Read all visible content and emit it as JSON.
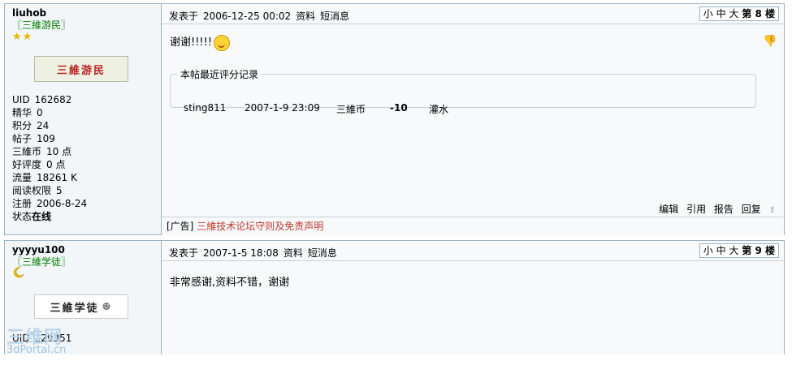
{
  "posts": [
    {
      "username": "liuhob",
      "group": "〖三維游民〗",
      "rank_stars": "★★",
      "badge_text": "三維游民",
      "stats": [
        {
          "label": "UID",
          "value": "162682"
        },
        {
          "label": "精华",
          "value": "0"
        },
        {
          "label": "积分",
          "value": "24"
        },
        {
          "label": "帖子",
          "value": "109"
        },
        {
          "label": "三維币",
          "value": "10 点"
        },
        {
          "label": "好评度",
          "value": "0 点"
        },
        {
          "label": "流量",
          "value": "18261 K"
        },
        {
          "label": "阅读权限",
          "value": "5"
        },
        {
          "label": "注册",
          "value": "2006-8-24"
        },
        {
          "label": "状态",
          "value": "在线"
        }
      ],
      "posted_prefix": "发表于",
      "posted_time": "2006-12-25 00:02",
      "profile_link": "资料",
      "pm_link": "短消息",
      "font_sizes": [
        "小",
        "中",
        "大"
      ],
      "floor_label": "第 8 楼",
      "content": "谢谢!!!!!",
      "rating": {
        "legend": "本帖最近评分记录",
        "user": "sting811",
        "time": "2007-1-9 23:09",
        "currency": "三維币",
        "amount": "-10",
        "reason": "灌水"
      },
      "actions": [
        "编辑",
        "引用",
        "报告",
        "回复"
      ],
      "ad_prefix": "[广告]",
      "ad_text": "三維技术论坛守则及免责声明"
    },
    {
      "username": "yyyyu100",
      "group": "〖三維学徒〗",
      "badge_text": "三維学徒",
      "uid_label": "UID",
      "uid_value": "129351",
      "posted_prefix": "发表于",
      "posted_time": "2007-1-5 18:08",
      "profile_link": "资料",
      "pm_link": "短消息",
      "font_sizes": [
        "小",
        "中",
        "大"
      ],
      "floor_label": "第 9 楼",
      "content": "非常感谢,资料不错，谢谢"
    }
  ],
  "watermark": {
    "title": "三维网",
    "url": "3dPortal.cn"
  }
}
